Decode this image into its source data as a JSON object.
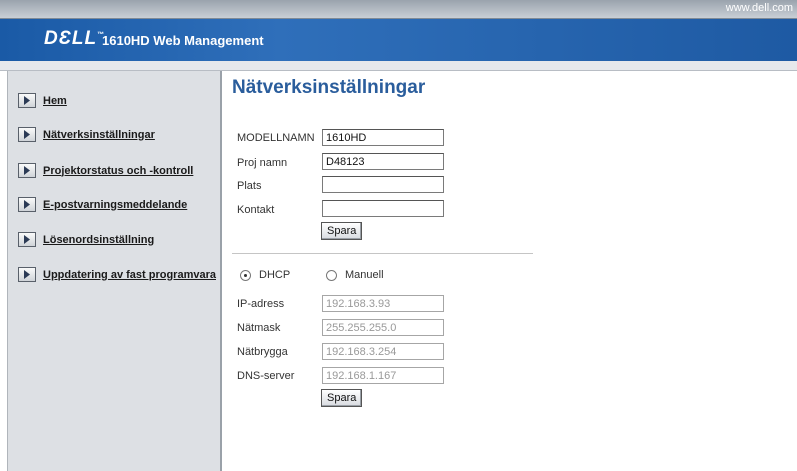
{
  "header": {
    "url_text": "www.dell.com",
    "logo_text": "DƐLL",
    "logo_tm": "™",
    "product_title": "1610HD Web Management"
  },
  "sidebar": {
    "items": [
      {
        "label": "Hem"
      },
      {
        "label": "Nätverksinställningar"
      },
      {
        "label": "Projektorstatus och -kontroll"
      },
      {
        "label": "E-postvarningsmeddelande"
      },
      {
        "label": "Lösenordsinställning"
      },
      {
        "label": "Uppdatering av fast programvara"
      }
    ]
  },
  "main": {
    "title": "Nätverksinställningar",
    "info": {
      "model_label": "MODELLNAMN",
      "model_value": "1610HD",
      "proj_label": "Proj namn",
      "proj_value": "D48123",
      "location_label": "Plats",
      "location_value": "",
      "contact_label": "Kontakt",
      "contact_value": "",
      "save_label": "Spara"
    },
    "network": {
      "mode_selected": "DHCP",
      "dhcp_label": "DHCP",
      "manual_label": "Manuell",
      "ip_label": "IP-adress",
      "ip_value": "192.168.3.93",
      "mask_label": "Nätmask",
      "mask_value": "255.255.255.0",
      "gateway_label": "Nätbrygga",
      "gateway_value": "192.168.3.254",
      "dns_label": "DNS-server",
      "dns_value": "192.168.1.167",
      "save_label": "Spara"
    }
  },
  "colors": {
    "banner_blue": "#1e5aa3",
    "title_blue": "#2a5d9c",
    "sidebar_bg": "#dde0e4"
  }
}
